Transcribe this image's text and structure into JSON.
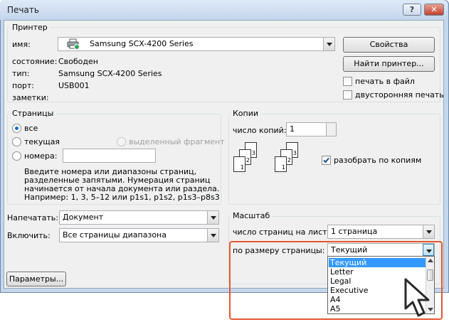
{
  "window": {
    "title": "Печать",
    "help_glyph": "?",
    "close_glyph": "✕"
  },
  "printer": {
    "group_label": "Принтер",
    "name_label": "имя:",
    "name_value": "Samsung SCX-4200 Series",
    "status_label": "состояние:",
    "status_value": "Свободен",
    "type_label": "тип:",
    "type_value": "Samsung SCX-4200 Series",
    "port_label": "порт:",
    "port_value": "USB001",
    "notes_label": "заметки:",
    "properties_button": "Свойства",
    "find_printer_button": "Найти принтер...",
    "print_to_file": "печать в файл",
    "duplex": "двусторонняя печать"
  },
  "pages": {
    "group_label": "Страницы",
    "all": "все",
    "current": "текущая",
    "selection": "выделенный фрагмент",
    "numbers": "номера:",
    "hint": [
      "Введите номера или диапазоны страниц,",
      "разделенные запятыми. Нумерация страниц",
      "начинается от начала документа или раздела.",
      "Например: 1, 3, 5–12 или p1s1, p1s2, p1s3–p8s3"
    ]
  },
  "copies": {
    "group_label": "Копии",
    "count_label": "число копий:",
    "count_value": "1",
    "collate": "разобрать по копиям",
    "page_numbers": [
      "1",
      "2",
      "3"
    ]
  },
  "print_what": {
    "label": "Напечатать:",
    "value": "Документ"
  },
  "include": {
    "label": "Включить:",
    "value": "Все страницы диапазона"
  },
  "zoom": {
    "group_label": "Масштаб",
    "pages_per_sheet_label": "число страниц на листе:",
    "pages_per_sheet_value": "1 страница",
    "scale_label": "по размеру страницы:",
    "scale_value": "Текущий",
    "options": [
      "Текущий",
      "Letter",
      "Legal",
      "Executive",
      "A4",
      "A5"
    ]
  },
  "options_button": "Параметры...",
  "colors": {
    "highlight": "#e4572e",
    "selection": "#3399ff"
  }
}
